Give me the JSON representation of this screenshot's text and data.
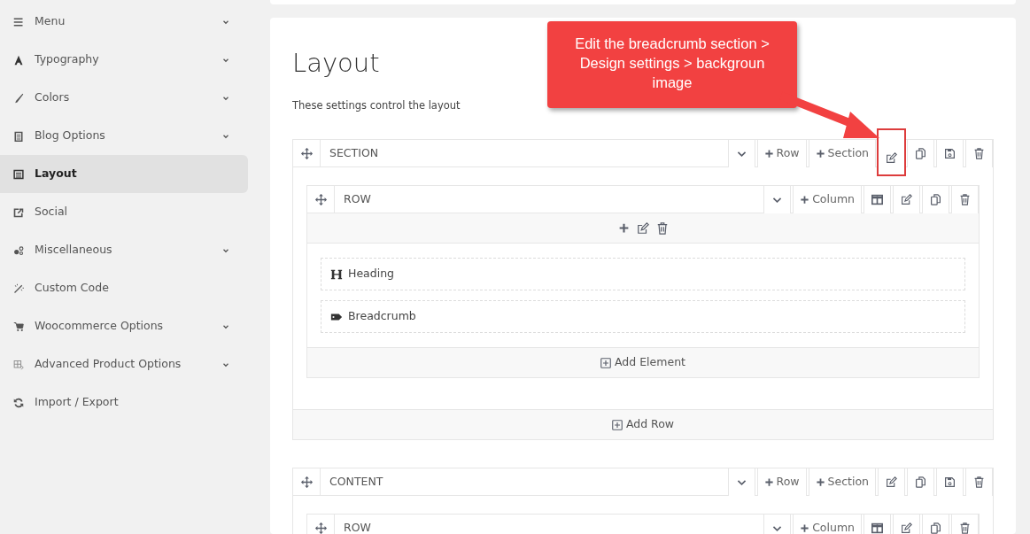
{
  "sidebar": {
    "items": [
      {
        "label": "Menu",
        "expandable": true,
        "selected": false
      },
      {
        "label": "Typography",
        "expandable": true,
        "selected": false
      },
      {
        "label": "Colors",
        "expandable": true,
        "selected": false
      },
      {
        "label": "Blog Options",
        "expandable": true,
        "selected": false
      },
      {
        "label": "Layout",
        "expandable": false,
        "selected": true
      },
      {
        "label": "Social",
        "expandable": false,
        "selected": false
      },
      {
        "label": "Miscellaneous",
        "expandable": true,
        "selected": false
      },
      {
        "label": "Custom Code",
        "expandable": false,
        "selected": false
      },
      {
        "label": "Woocommerce Options",
        "expandable": true,
        "selected": false
      },
      {
        "label": "Advanced Product Options",
        "expandable": true,
        "selected": false
      },
      {
        "label": "Import / Export",
        "expandable": false,
        "selected": false
      }
    ]
  },
  "page": {
    "title": "Layout",
    "description": "These settings control the layout",
    "sections": [
      {
        "label": "SECTION",
        "toolbar": [
          {
            "kind": "collapse",
            "highlighted": false
          },
          {
            "kind": "add",
            "label": "Row",
            "highlighted": false
          },
          {
            "kind": "add",
            "label": "Section",
            "highlighted": false
          },
          {
            "kind": "edit",
            "highlighted": true
          },
          {
            "kind": "copy",
            "highlighted": false
          },
          {
            "kind": "save",
            "highlighted": false
          },
          {
            "kind": "delete",
            "highlighted": false
          }
        ],
        "rows": [
          {
            "label": "ROW",
            "toolbar": [
              {
                "kind": "collapse",
                "highlighted": false
              },
              {
                "kind": "add",
                "label": "Column",
                "highlighted": false
              },
              {
                "kind": "columns",
                "highlighted": false
              },
              {
                "kind": "edit",
                "highlighted": false
              },
              {
                "kind": "copy",
                "highlighted": false
              },
              {
                "kind": "delete",
                "highlighted": false
              }
            ],
            "elements": [
              {
                "kind": "heading",
                "label": "Heading"
              },
              {
                "kind": "tag",
                "label": "Breadcrumb"
              }
            ],
            "add_element": "Add Element"
          }
        ],
        "add_row": "Add Row"
      },
      {
        "label": "CONTENT",
        "toolbar": [
          {
            "kind": "collapse",
            "highlighted": false
          },
          {
            "kind": "add",
            "label": "Row",
            "highlighted": false
          },
          {
            "kind": "add",
            "label": "Section",
            "highlighted": false
          },
          {
            "kind": "edit",
            "highlighted": false
          },
          {
            "kind": "copy",
            "highlighted": false
          },
          {
            "kind": "save",
            "highlighted": false
          },
          {
            "kind": "delete",
            "highlighted": false
          }
        ],
        "rows": [
          {
            "label": "ROW",
            "toolbar": [
              {
                "kind": "collapse",
                "highlighted": false
              },
              {
                "kind": "add",
                "label": "Column",
                "highlighted": false
              },
              {
                "kind": "columns",
                "highlighted": false
              },
              {
                "kind": "edit",
                "highlighted": false
              },
              {
                "kind": "copy",
                "highlighted": false
              },
              {
                "kind": "delete",
                "highlighted": false
              }
            ]
          }
        ]
      }
    ]
  },
  "callout": {
    "text": "Edit the breadcrumb section > Design settings > backgroun image"
  }
}
